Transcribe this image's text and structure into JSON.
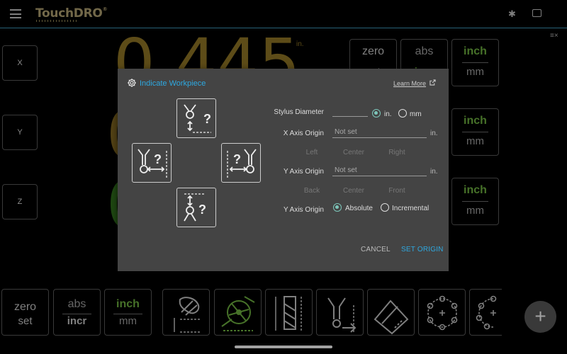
{
  "topbar": {
    "logo": "TouchDRO",
    "logo_mark": "®",
    "bluetooth_glyph": "✱",
    "collapse_glyph": "≡×"
  },
  "axes": [
    {
      "label": "X"
    },
    {
      "label": "Y"
    },
    {
      "label": "Z"
    }
  ],
  "readouts": {
    "x_value": "0.445",
    "x_unit": "in.",
    "y_value": "0",
    "z_value": "0"
  },
  "right_buttons": {
    "zero_top": "zero",
    "zero_bottom": "set",
    "abs_top": "abs",
    "abs_bottom": "incr",
    "inch": "inch",
    "mm": "mm"
  },
  "bottom_toolbar": {
    "zero": "zero",
    "set": "set",
    "abs": "abs",
    "incr": "incr",
    "inch": "inch",
    "mm": "mm",
    "fab": "+"
  },
  "dialog": {
    "title": "Indicate Workpiece",
    "learn_more": "Learn More",
    "stylus_label": "Stylus Diameter",
    "stylus_value": "",
    "unit_in": "in.",
    "unit_mm": "mm",
    "stylus_unit": "in.",
    "x_label": "X Axis Origin",
    "x_value": "Not set",
    "x_unit": "in.",
    "x_options": [
      "Left",
      "Center",
      "Right"
    ],
    "y_label": "Y Axis Origin",
    "y_value": "Not set",
    "y_unit": "in.",
    "y_options": [
      "Back",
      "Center",
      "Front"
    ],
    "mode_label": "Y Axis Origin",
    "mode_absolute": "Absolute",
    "mode_incremental": "Incremental",
    "mode_selected": "Absolute",
    "cancel": "CANCEL",
    "set_origin": "SET ORIGIN",
    "colors": {
      "accent": "#2ea8e0",
      "radio": "#7cc5b9",
      "panel": "#444444"
    }
  }
}
